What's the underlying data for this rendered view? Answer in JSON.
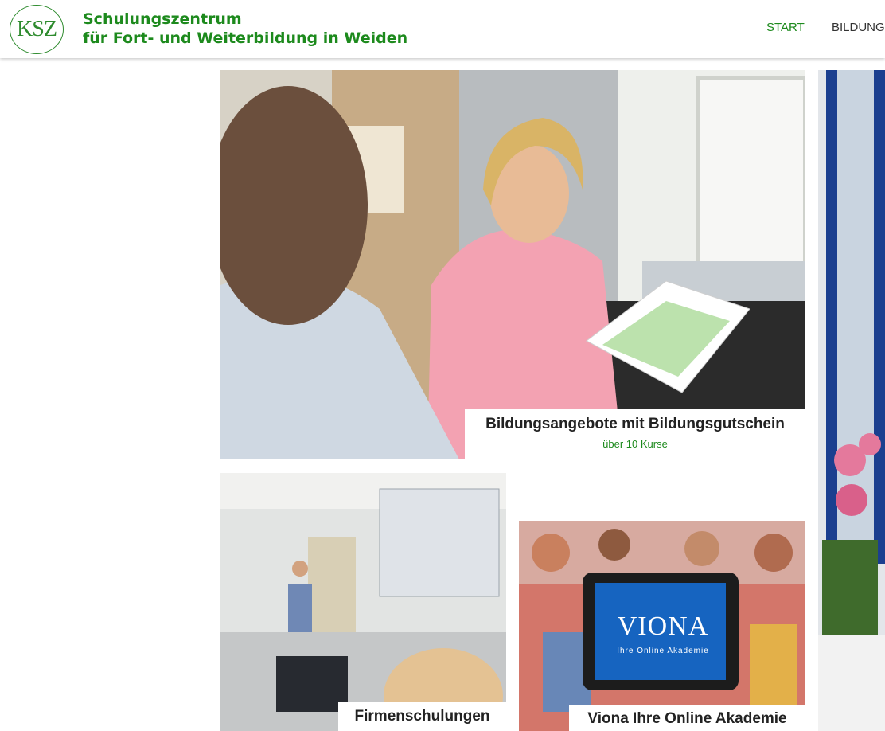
{
  "header": {
    "logo_text": "KSZ",
    "brand_line1": "Schulungszentrum",
    "brand_line2": "für Fort- und Weiterbildung in Weiden",
    "nav": [
      {
        "label": "START",
        "active": true
      },
      {
        "label": "BILDUNGS",
        "active": false
      }
    ]
  },
  "tiles": [
    {
      "title": "Bildungsangebote mit Bildungsgutschein",
      "subtitle": "über 10 Kurse"
    },
    {
      "title": "Firmenschulungen"
    },
    {
      "title": "Viona Ihre Online Akademie",
      "tablet_brand": "VIONA",
      "tablet_tagline": "Ihre Online Akademie"
    }
  ],
  "colors": {
    "brand_green": "#1d8a1d",
    "nav_text": "#333333"
  }
}
